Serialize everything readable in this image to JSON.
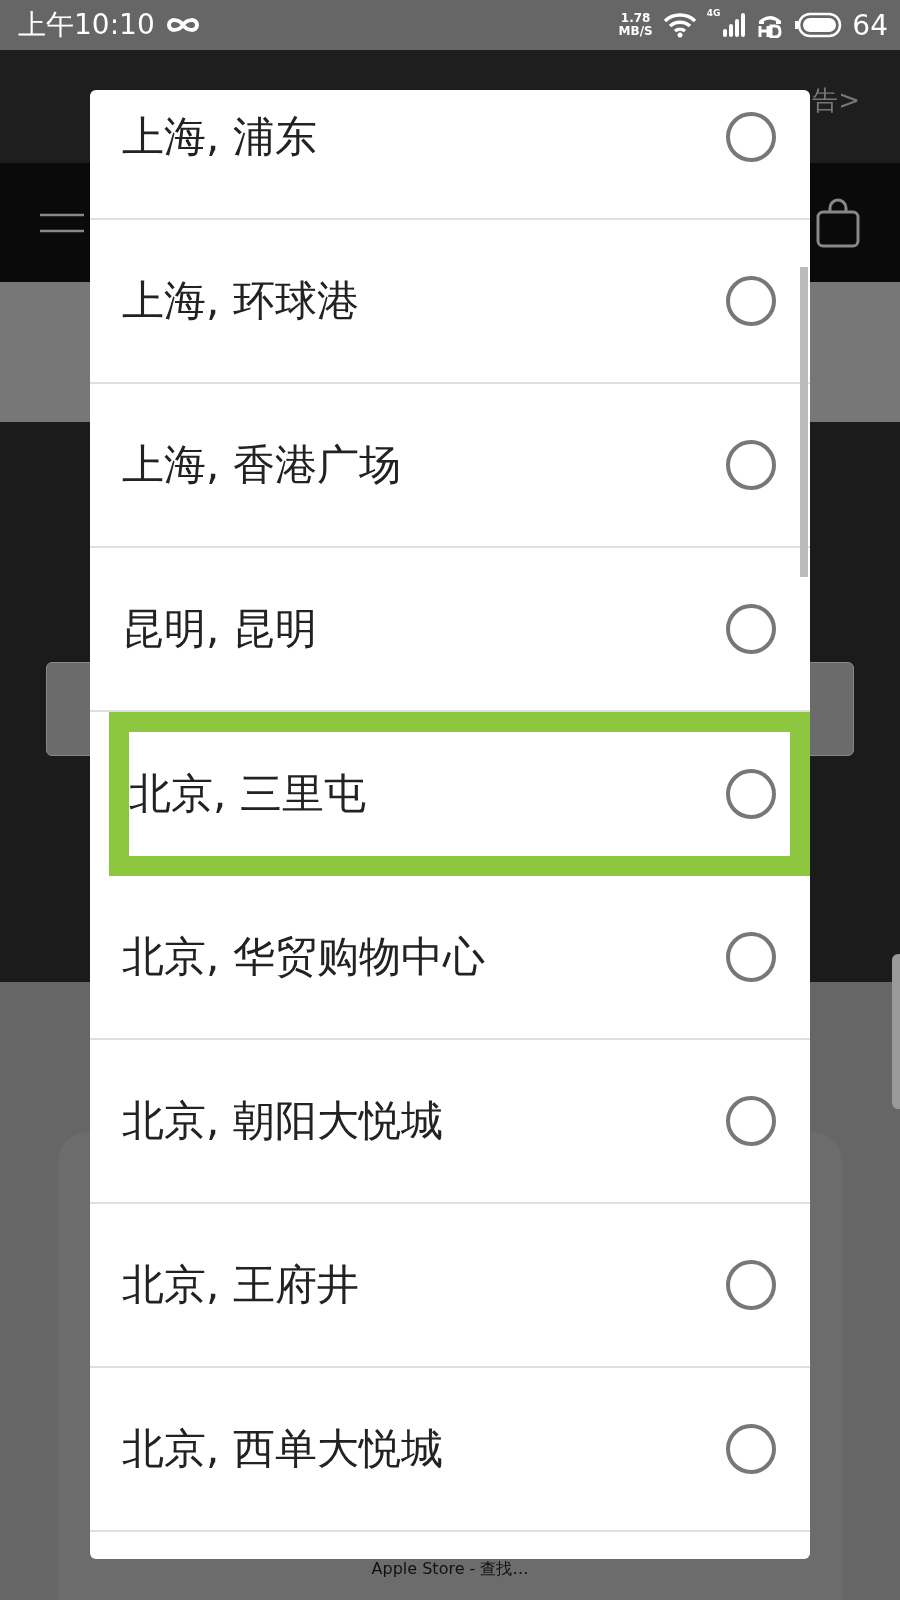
{
  "status_bar": {
    "time": "上午10:10",
    "speed_value": "1.78",
    "speed_unit": "MB/S",
    "network": "4G",
    "battery": "64"
  },
  "header": {
    "link": "告>"
  },
  "dialog": {
    "options": [
      {
        "label": "上海, 浦东",
        "selected": false,
        "highlighted": false
      },
      {
        "label": "上海, 环球港",
        "selected": false,
        "highlighted": false
      },
      {
        "label": "上海, 香港广场",
        "selected": false,
        "highlighted": false
      },
      {
        "label": "昆明, 昆明",
        "selected": false,
        "highlighted": false
      },
      {
        "label": "北京, 三里屯",
        "selected": false,
        "highlighted": true
      },
      {
        "label": "北京, 华贸购物中心",
        "selected": false,
        "highlighted": false
      },
      {
        "label": "北京, 朝阳大悦城",
        "selected": false,
        "highlighted": false
      },
      {
        "label": "北京, 王府井",
        "selected": false,
        "highlighted": false
      },
      {
        "label": "北京, 西单大悦城",
        "selected": false,
        "highlighted": false
      }
    ]
  },
  "footer": {
    "title": "Apple Store - 查找…"
  }
}
